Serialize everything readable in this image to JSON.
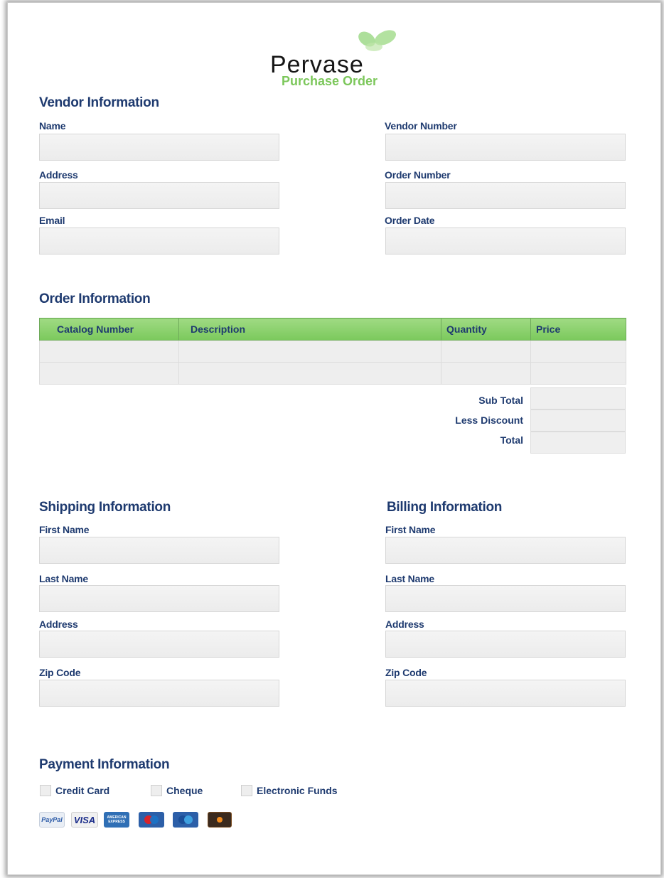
{
  "header": {
    "brand": "Pervase",
    "subtitle": "Purchase Order"
  },
  "vendor": {
    "heading": "Vendor Information",
    "name_label": "Name",
    "address_label": "Address",
    "email_label": "Email",
    "vendor_number_label": "Vendor Number",
    "order_number_label": "Order Number",
    "order_date_label": "Order Date"
  },
  "order": {
    "heading": "Order Information",
    "columns": [
      "Catalog Number",
      "Description",
      "Quantity",
      "Price"
    ],
    "sub_total_label": "Sub Total",
    "less_discount_label": "Less Discount",
    "total_label": "Total"
  },
  "shipping": {
    "heading": "Shipping Information",
    "first_name_label": "First Name",
    "last_name_label": "Last Name",
    "address_label": "Address",
    "zip_label": "Zip Code"
  },
  "billing": {
    "heading": "Billing Information",
    "first_name_label": "First Name",
    "last_name_label": "Last Name",
    "address_label": "Address",
    "zip_label": "Zip Code"
  },
  "payment": {
    "heading": "Payment Information",
    "options": [
      "Credit Card",
      "Cheque",
      "Electronic Funds"
    ],
    "cards": [
      "PayPal",
      "VISA",
      "AMERICAN EXPRESS",
      "Maestro",
      "Cirrus",
      "DISCOVER"
    ]
  },
  "colors": {
    "heading": "#1e3a6f",
    "accent": "#7cc75b"
  }
}
